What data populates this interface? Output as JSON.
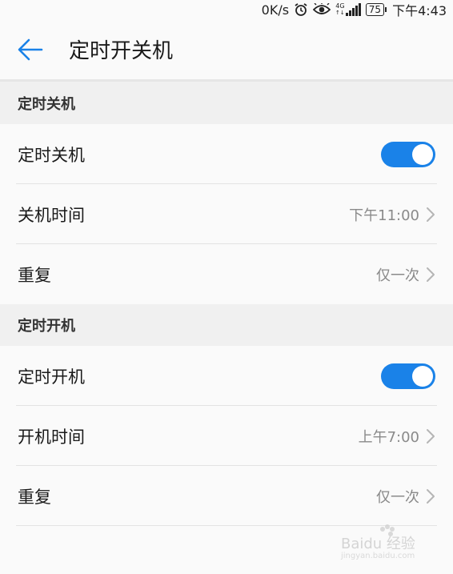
{
  "status_bar": {
    "net_speed": "0K/s",
    "network_type": "4G",
    "battery": "75",
    "time": "下午4:43",
    "icons": [
      "alarm-icon",
      "eye-comfort-icon",
      "signal-icon",
      "battery-icon"
    ]
  },
  "header": {
    "back_icon": "arrow-left-icon",
    "title": "定时开关机"
  },
  "sections": [
    {
      "header": "定时关机",
      "toggle_row": {
        "label": "定时关机",
        "enabled": true
      },
      "time_row": {
        "label": "关机时间",
        "value": "下午11:00"
      },
      "repeat_row": {
        "label": "重复",
        "value": "仅一次"
      }
    },
    {
      "header": "定时开机",
      "toggle_row": {
        "label": "定时开机",
        "enabled": true
      },
      "time_row": {
        "label": "开机时间",
        "value": "上午7:00"
      },
      "repeat_row": {
        "label": "重复",
        "value": "仅一次"
      }
    }
  ],
  "colors": {
    "accent": "#1a82e8",
    "background": "#fafafa",
    "section_bg": "#f0f0f0",
    "value_text": "#8a8a8a"
  },
  "watermark": {
    "text": "Baidu 经验",
    "subtext": "jingyan.baidu.com"
  }
}
